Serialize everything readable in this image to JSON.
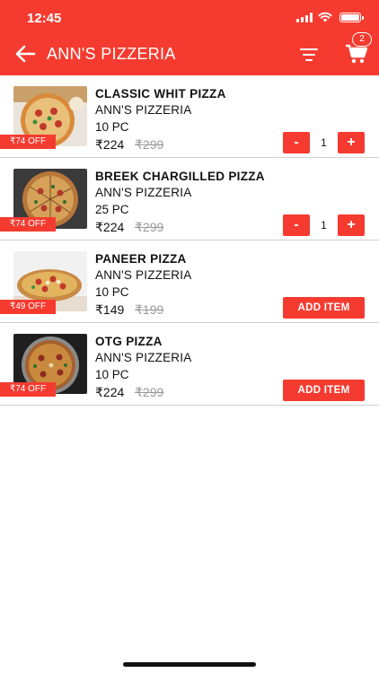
{
  "status_bar": {
    "time": "12:45"
  },
  "header": {
    "title": "ANN'S PIZZERIA",
    "cart_count": "2",
    "back_icon": "arrow-left-icon",
    "filter_icon": "filter-icon",
    "cart_icon": "cart-icon"
  },
  "colors": {
    "accent": "#f53b30",
    "divider": "#cfcfcf",
    "strike": "#9a9a9a"
  },
  "items": [
    {
      "name": "CLASSIC WHIT PIZZA",
      "store": "ANN'S PIZZERIA",
      "quantity_label": "10 PC",
      "price": "₹224",
      "mrp": "₹299",
      "discount": "₹74 OFF",
      "minus_label": "-",
      "plus_label": "+",
      "count": "1"
    },
    {
      "name": "BREEK CHARGILLED PIZZA",
      "store": "ANN'S PIZZERIA",
      "quantity_label": "25 PC",
      "price": "₹224",
      "mrp": "₹299",
      "discount": "₹74 OFF",
      "minus_label": "-",
      "plus_label": "+",
      "count": "1"
    },
    {
      "name": "PANEER PIZZA",
      "store": "ANN'S PIZZERIA",
      "quantity_label": "10 PC",
      "price": "₹149",
      "mrp": "₹199",
      "discount": "₹49 OFF",
      "add_label": "ADD ITEM"
    },
    {
      "name": "OTG PIZZA",
      "store": "ANN'S PIZZERIA",
      "quantity_label": "10 PC",
      "price": "₹224",
      "mrp": "₹299",
      "discount": "₹74 OFF",
      "add_label": "ADD ITEM"
    }
  ]
}
